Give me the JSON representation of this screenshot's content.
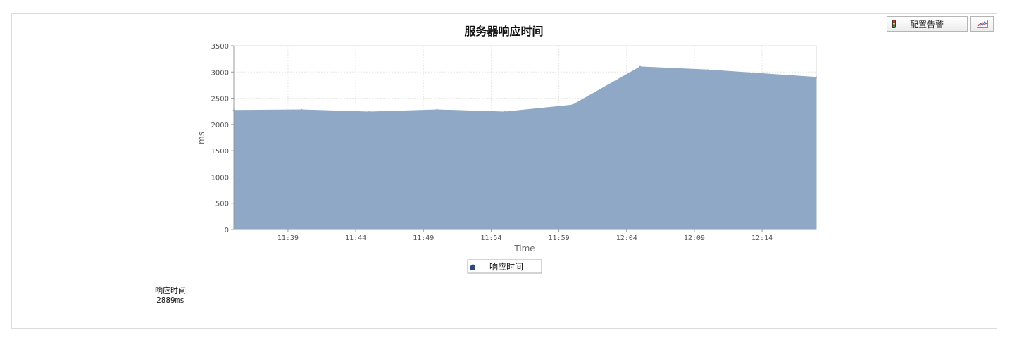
{
  "toolbar": {
    "alarm_label": "配置告警"
  },
  "colors": {
    "area_fill": "#8fa8c5",
    "legend_marker": "#2e4a7a",
    "grid": "#e6e6e6",
    "axis_text": "#555555"
  },
  "chart_data": {
    "type": "area",
    "title": "服务器响应时间",
    "xlabel": "Time",
    "ylabel": "ms",
    "ylim": [
      0,
      3500
    ],
    "yticks": [
      0,
      500,
      1000,
      1500,
      2000,
      2500,
      3000,
      3500
    ],
    "xlim": [
      "11:35",
      "12:18"
    ],
    "xticks": [
      "11:39",
      "11:44",
      "11:49",
      "11:54",
      "11:59",
      "12:04",
      "12:09",
      "12:14"
    ],
    "grid": true,
    "legend_position": "bottom-center",
    "series": [
      {
        "name": "响应时间",
        "x": [
          "11:35",
          "11:40",
          "11:45",
          "11:50",
          "11:55",
          "12:00",
          "12:05",
          "12:10",
          "12:18"
        ],
        "values": [
          2270,
          2280,
          2240,
          2280,
          2240,
          2370,
          3100,
          3040,
          2900
        ]
      }
    ]
  },
  "summary": {
    "label": "响应时间",
    "value": "2889ms"
  }
}
